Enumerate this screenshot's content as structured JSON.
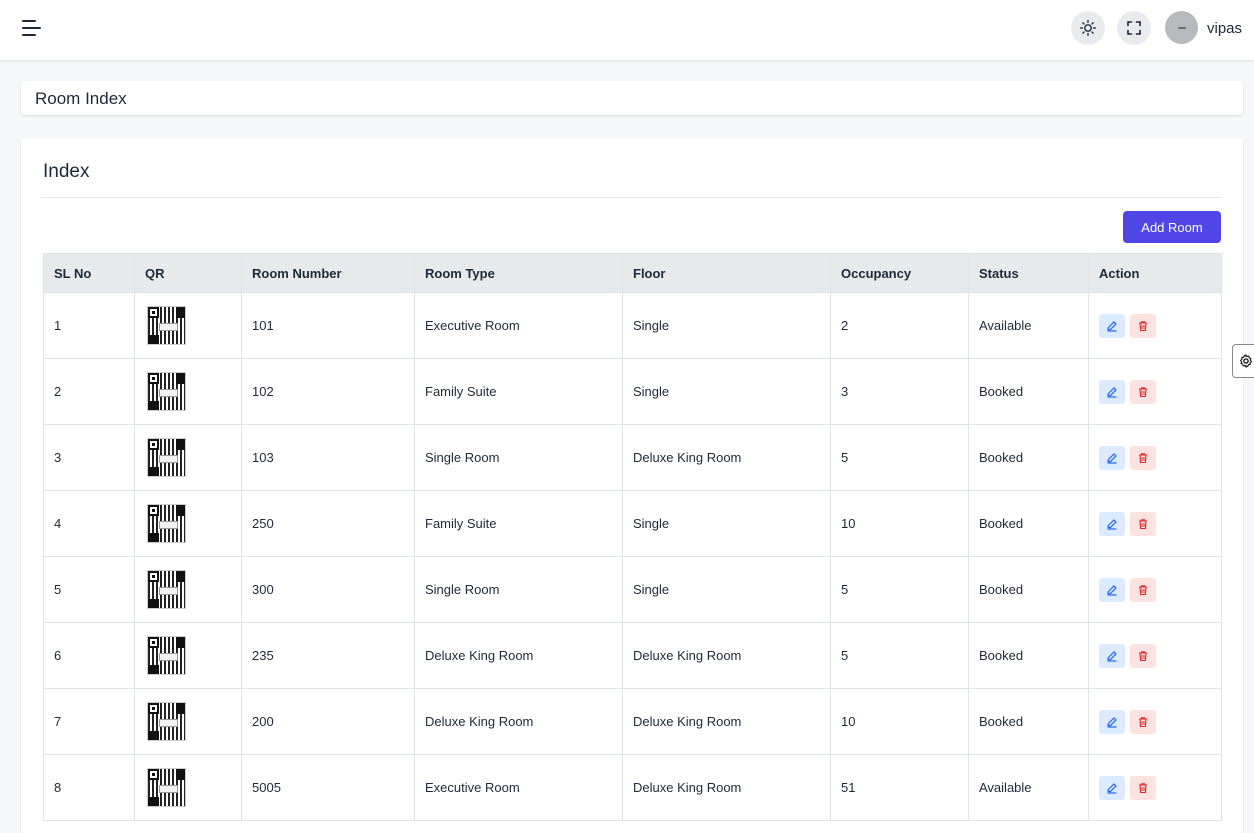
{
  "header": {
    "username": "vipas",
    "icons": [
      "menu-icon",
      "sun-icon",
      "fullscreen-icon",
      "avatar"
    ]
  },
  "breadcrumb": {
    "title": "Room Index"
  },
  "card": {
    "title": "Index",
    "add_button_label": "Add Room"
  },
  "table": {
    "columns": [
      "SL No",
      "QR",
      "Room Number",
      "Room Type",
      "Floor",
      "Occupancy",
      "Status",
      "Action"
    ],
    "rows": [
      {
        "sl": "1",
        "room_number": "101",
        "room_type": "Executive Room",
        "floor": "Single",
        "occupancy": "2",
        "status": "Available"
      },
      {
        "sl": "2",
        "room_number": "102",
        "room_type": "Family Suite",
        "floor": "Single",
        "occupancy": "3",
        "status": "Booked"
      },
      {
        "sl": "3",
        "room_number": "103",
        "room_type": "Single Room",
        "floor": "Deluxe King Room",
        "occupancy": "5",
        "status": "Booked"
      },
      {
        "sl": "4",
        "room_number": "250",
        "room_type": "Family Suite",
        "floor": "Single",
        "occupancy": "10",
        "status": "Booked"
      },
      {
        "sl": "5",
        "room_number": "300",
        "room_type": "Single Room",
        "floor": "Single",
        "occupancy": "5",
        "status": "Booked"
      },
      {
        "sl": "6",
        "room_number": "235",
        "room_type": "Deluxe King Room",
        "floor": "Deluxe King Room",
        "occupancy": "5",
        "status": "Booked"
      },
      {
        "sl": "7",
        "room_number": "200",
        "room_type": "Deluxe King Room",
        "floor": "Deluxe King Room",
        "occupancy": "10",
        "status": "Booked"
      },
      {
        "sl": "8",
        "room_number": "5005",
        "room_type": "Executive Room",
        "floor": "Deluxe King Room",
        "occupancy": "51",
        "status": "Available"
      }
    ]
  },
  "colors": {
    "primary": "#4f46e5",
    "edit_bg": "#dbeafe",
    "edit_icon": "#2563eb",
    "delete_bg": "#fde2e2",
    "delete_icon": "#dc2626"
  }
}
